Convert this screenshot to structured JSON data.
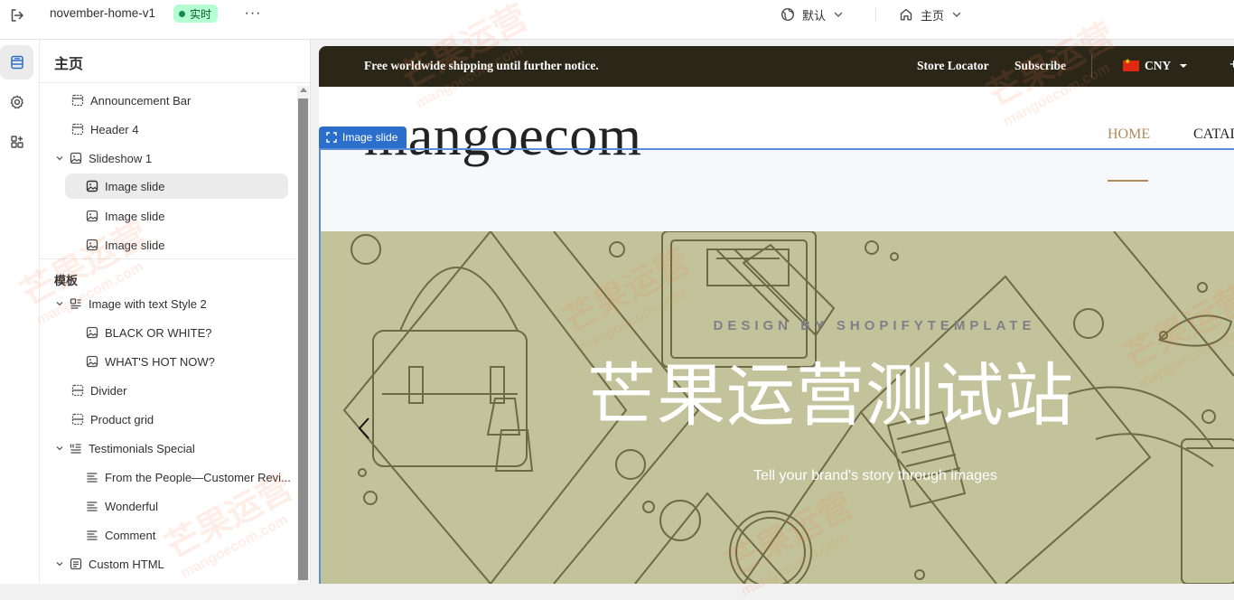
{
  "topbar": {
    "theme_name": "november-home-v1",
    "live_label": "实时",
    "more_label": "···",
    "locale_label": "默认",
    "page_label": "主页"
  },
  "sidebar": {
    "title": "主页",
    "items": [
      {
        "label": "Announcement Bar",
        "icon": "section-icon"
      },
      {
        "label": "Header 4",
        "icon": "section-icon"
      },
      {
        "label": "Slideshow 1",
        "icon": "slideshow-icon"
      },
      {
        "label": "Image slide",
        "icon": "image-icon"
      },
      {
        "label": "Image slide",
        "icon": "image-icon"
      },
      {
        "label": "Image slide",
        "icon": "image-icon"
      }
    ],
    "group_label": "模板",
    "template_items": [
      {
        "label": "Image with text Style 2",
        "icon": "image-text-icon"
      },
      {
        "label": "BLACK OR WHITE?",
        "icon": "image-icon"
      },
      {
        "label": "WHAT'S HOT NOW?",
        "icon": "image-icon"
      },
      {
        "label": "Divider",
        "icon": "section-icon"
      },
      {
        "label": "Product grid",
        "icon": "section-icon"
      },
      {
        "label": "Testimonials Special",
        "icon": "list-icon"
      },
      {
        "label": "From the People—Customer Revi...",
        "icon": "text-icon"
      },
      {
        "label": "Wonderful",
        "icon": "text-icon"
      },
      {
        "label": "Comment",
        "icon": "text-icon"
      },
      {
        "label": "Custom HTML",
        "icon": "html-icon"
      }
    ]
  },
  "preview": {
    "announcement": {
      "message": "Free worldwide shipping until further notice.",
      "store_locator": "Store Locator",
      "subscribe": "Subscribe",
      "currency": "CNY",
      "plus": "+"
    },
    "header": {
      "logo": "mangoecom",
      "nav_home": "HOME",
      "nav_catalog": "CATAL"
    },
    "selection_tag": "Image slide",
    "slide": {
      "kicker": "DESIGN BY SHOPIFYTEMPLATE",
      "headline": "芒果运营测试站",
      "subtext": "Tell your brand's story through images"
    }
  },
  "watermark": {
    "text": "芒果运营",
    "domain": "mangoecom.com"
  },
  "colors": {
    "announcement_bg": "#2a2618",
    "slide_bg": "#c2c39a",
    "nav_accent": "#b08a5c",
    "live_badge_bg": "#b4fed2",
    "selection_blue": "#2c6ecb"
  }
}
